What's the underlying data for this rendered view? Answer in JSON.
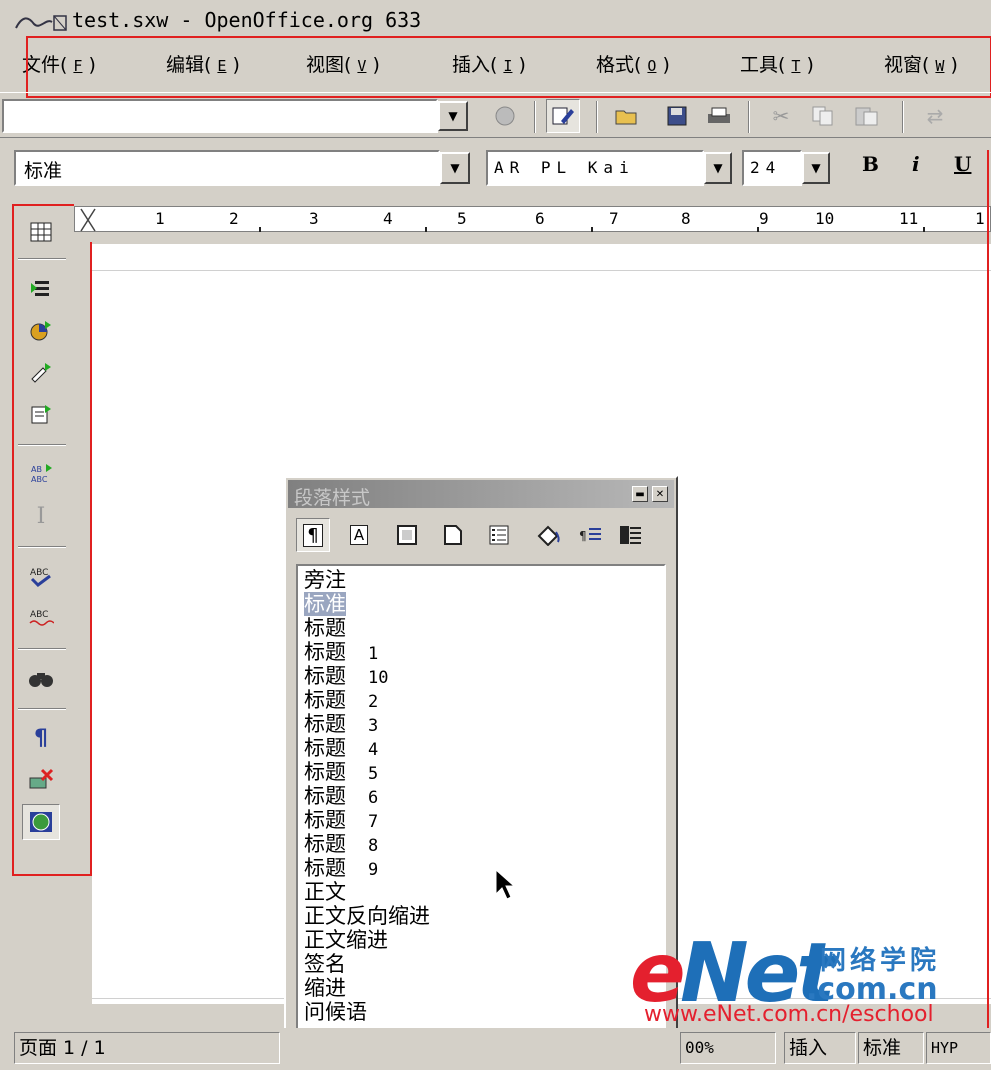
{
  "window": {
    "title": "test.sxw - OpenOffice.org 633",
    "icon": "openoffice-app-icon"
  },
  "menubar": {
    "items": [
      {
        "label": "文件(",
        "key": "F",
        "close": ")"
      },
      {
        "label": "编辑(",
        "key": "E",
        "close": ")"
      },
      {
        "label": "视图(",
        "key": "V",
        "close": ")"
      },
      {
        "label": "插入(",
        "key": "I",
        "close": ")"
      },
      {
        "label": "格式(",
        "key": "O",
        "close": ")"
      },
      {
        "label": "工具(",
        "key": "T",
        "close": ")"
      },
      {
        "label": "视窗(",
        "key": "W",
        "close": ")"
      }
    ]
  },
  "toolbar": {
    "url_value": "",
    "icons": [
      "stop-icon",
      "edit-file-icon",
      "open-folder-icon",
      "save-icon",
      "print-icon",
      "cut-icon",
      "copy-icon",
      "paste-icon",
      "undo-icon"
    ]
  },
  "format_toolbar": {
    "paragraph_style": "标准",
    "font_name": "AR PL Kai",
    "font_size": "24",
    "bold": "B",
    "italic": "i",
    "underline": "U"
  },
  "main_toolbar": {
    "icons": [
      "insert-table-icon",
      "insert-fields-icon",
      "insert-object-icon",
      "draw-functions-icon",
      "form-functions-icon",
      "autospellcheck-icon",
      "text-cursor-icon",
      "spellcheck-icon",
      "spellcheck-auto-icon",
      "find-replace-icon",
      "formatting-marks-icon",
      "online-layout-icon",
      "navigator-icon"
    ]
  },
  "ruler": {
    "labels": [
      "1",
      "2",
      "3",
      "4",
      "5",
      "6",
      "7",
      "8",
      "9",
      "10",
      "11",
      "1"
    ]
  },
  "stylist": {
    "title": "段落样式",
    "styles": [
      {
        "name": "旁注",
        "num": ""
      },
      {
        "name": "标准",
        "num": "",
        "selected": true
      },
      {
        "name": "标题",
        "num": ""
      },
      {
        "name": "标题",
        "num": "1"
      },
      {
        "name": "标题",
        "num": "10"
      },
      {
        "name": "标题",
        "num": "2"
      },
      {
        "name": "标题",
        "num": "3"
      },
      {
        "name": "标题",
        "num": "4"
      },
      {
        "name": "标题",
        "num": "5"
      },
      {
        "name": "标题",
        "num": "6"
      },
      {
        "name": "标题",
        "num": "7"
      },
      {
        "name": "标题",
        "num": "8"
      },
      {
        "name": "标题",
        "num": "9"
      },
      {
        "name": "正文",
        "num": ""
      },
      {
        "name": "正文反向缩进",
        "num": ""
      },
      {
        "name": "正文缩进",
        "num": ""
      },
      {
        "name": "签名",
        "num": ""
      },
      {
        "name": "缩进",
        "num": ""
      },
      {
        "name": "问候语",
        "num": ""
      }
    ]
  },
  "statusbar": {
    "page": "页面 1 / 1",
    "zoom": "00%",
    "insert_mode": "插入",
    "selection_mode": "标准",
    "hyperlink": "HYP"
  },
  "watermark": {
    "brand_e": "e",
    "brand_net": "Net",
    "cn_name": "网络学院",
    "domain": ".com.cn",
    "url": "www.eNet.com.cn/eschool"
  },
  "colors": {
    "highlight_box": "#e02020",
    "chrome": "#d4d0c8"
  }
}
